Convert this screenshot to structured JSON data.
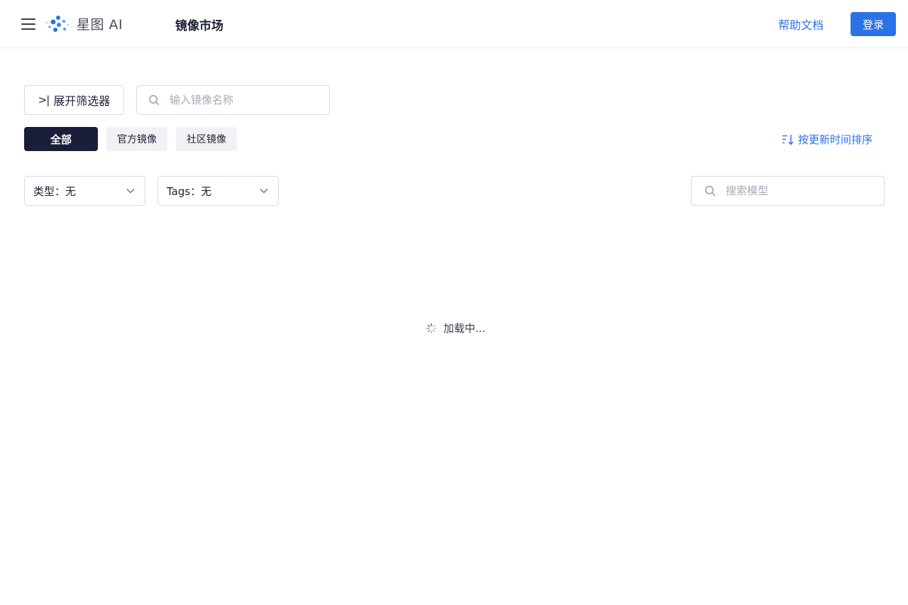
{
  "header": {
    "brand": "星图 AI",
    "page_title": "镜像市场",
    "help_label": "帮助文档",
    "login_label": "登录"
  },
  "toolbar": {
    "filter_label": "展开筛选器",
    "name_search_placeholder": "输入镜像名称"
  },
  "tabs": [
    {
      "label": "全部",
      "active": true
    },
    {
      "label": "官方镜像",
      "active": false
    },
    {
      "label": "社区镜像",
      "active": false
    }
  ],
  "sort": {
    "label": "按更新时间排序"
  },
  "filters": {
    "type_label": "类型：无",
    "tags_label": "Tags：无",
    "model_search_placeholder": "搜索模型"
  },
  "status": {
    "loading_text": "加载中..."
  },
  "colors": {
    "accent": "#2b72e6",
    "active_tab": "#1b1e38",
    "tab_bg": "#f1f2f6"
  },
  "icons": [
    "menu-icon",
    "logo-icon",
    "expand-icon",
    "search-icon",
    "sort-icon",
    "chevron-down-icon",
    "spinner-icon"
  ]
}
